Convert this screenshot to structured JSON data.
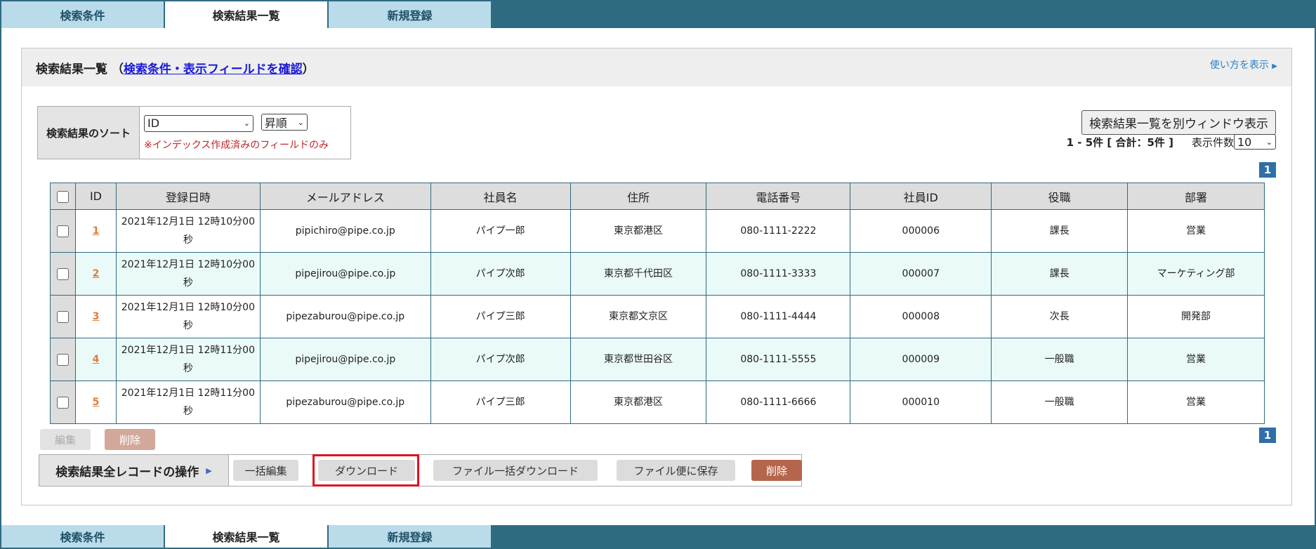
{
  "tabs": [
    "検索条件",
    "検索結果一覧",
    "新規登録"
  ],
  "active_tab": 1,
  "panel": {
    "title_prefix": "検索結果一覧 （",
    "title_link": "検索条件・表示フィールドを確認",
    "title_suffix": "）",
    "help_link": "使い方を表示",
    "help_icon": "triangle-right-icon"
  },
  "sort": {
    "label": "検索結果のソート",
    "field_value": "ID",
    "order_value": "昇順",
    "note": "※インデックス作成済みのフィールドのみ"
  },
  "window_button": "検索結果一覧を別ウィンドウ表示",
  "count_text": "1 - 5件 [ 合計：5件 ]",
  "per_page_label": "表示件数",
  "per_page_value": "10",
  "page_number": "1",
  "columns": [
    "ID",
    "登録日時",
    "メールアドレス",
    "社員名",
    "住所",
    "電話番号",
    "社員ID",
    "役職",
    "部署"
  ],
  "rows": [
    {
      "id": "1",
      "date1": "2021年12月1日 12時10分00",
      "date2": "秒",
      "email": "pipichiro@pipe.co.jp",
      "name": "パイプ一郎",
      "address": "東京都港区",
      "phone": "080-1111-2222",
      "empid": "000006",
      "title": "課長",
      "dept": "営業"
    },
    {
      "id": "2",
      "date1": "2021年12月1日 12時10分00",
      "date2": "秒",
      "email": "pipejirou@pipe.co.jp",
      "name": "パイプ次郎",
      "address": "東京都千代田区",
      "phone": "080-1111-3333",
      "empid": "000007",
      "title": "課長",
      "dept": "マーケティング部"
    },
    {
      "id": "3",
      "date1": "2021年12月1日 12時10分00",
      "date2": "秒",
      "email": "pipezaburou@pipe.co.jp",
      "name": "パイプ三郎",
      "address": "東京都文京区",
      "phone": "080-1111-4444",
      "empid": "000008",
      "title": "次長",
      "dept": "開発部"
    },
    {
      "id": "4",
      "date1": "2021年12月1日 12時11分00",
      "date2": "秒",
      "email": "pipejirou@pipe.co.jp",
      "name": "パイプ次郎",
      "address": "東京都世田谷区",
      "phone": "080-1111-5555",
      "empid": "000009",
      "title": "一般職",
      "dept": "営業"
    },
    {
      "id": "5",
      "date1": "2021年12月1日 12時11分00",
      "date2": "秒",
      "email": "pipezaburou@pipe.co.jp",
      "name": "パイプ三郎",
      "address": "東京都港区",
      "phone": "080-1111-6666",
      "empid": "000010",
      "title": "一般職",
      "dept": "営業"
    }
  ],
  "row_buttons": {
    "edit": "編集",
    "delete": "削除"
  },
  "ops": {
    "label": "検索結果全レコードの操作",
    "bulk_edit": "一括編集",
    "download": "ダウンロード",
    "file_bulk_download": "ファイル一括ダウンロード",
    "save_to_file_box": "ファイル便に保存",
    "delete": "削除"
  },
  "colors": {
    "accent": "#2f6b80",
    "tab_bg": "#b9dbea",
    "highlight": "#e01020",
    "delete": "#b5654c"
  }
}
